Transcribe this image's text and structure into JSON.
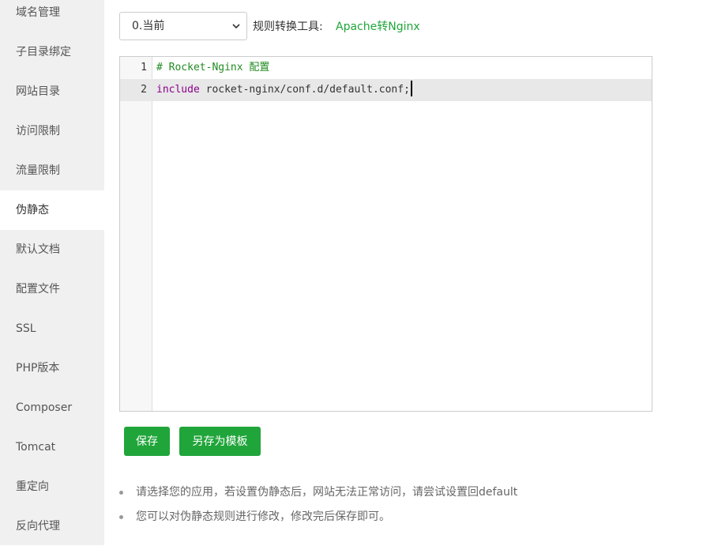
{
  "sidebar": {
    "items": [
      {
        "label": "域名管理"
      },
      {
        "label": "子目录绑定"
      },
      {
        "label": "网站目录"
      },
      {
        "label": "访问限制"
      },
      {
        "label": "流量限制"
      },
      {
        "label": "伪静态",
        "active": true
      },
      {
        "label": "默认文档"
      },
      {
        "label": "配置文件"
      },
      {
        "label": "SSL"
      },
      {
        "label": "PHP版本"
      },
      {
        "label": "Composer"
      },
      {
        "label": "Tomcat"
      },
      {
        "label": "重定向"
      },
      {
        "label": "反向代理"
      }
    ]
  },
  "toolbar": {
    "version_select": "0.当前",
    "tool_label": "规则转换工具:",
    "tool_link": "Apache转Nginx"
  },
  "editor": {
    "lines": [
      {
        "num": "1",
        "text": "# Rocket-Nginx 配置"
      },
      {
        "num": "2",
        "keyword": "include",
        "rest": " rocket-nginx/conf.d/default.conf;"
      }
    ]
  },
  "buttons": {
    "save": "保存",
    "save_as_template": "另存为模板"
  },
  "tips": [
    "请选择您的应用，若设置伪静态后，网站无法正常访问，请尝试设置回default",
    "您可以对伪静态规则进行修改，修改完后保存即可。"
  ],
  "colors": {
    "accent": "#20a53a",
    "sidebar_bg": "#f0f0f0",
    "comment": "#228b22",
    "keyword": "#8b008b"
  }
}
